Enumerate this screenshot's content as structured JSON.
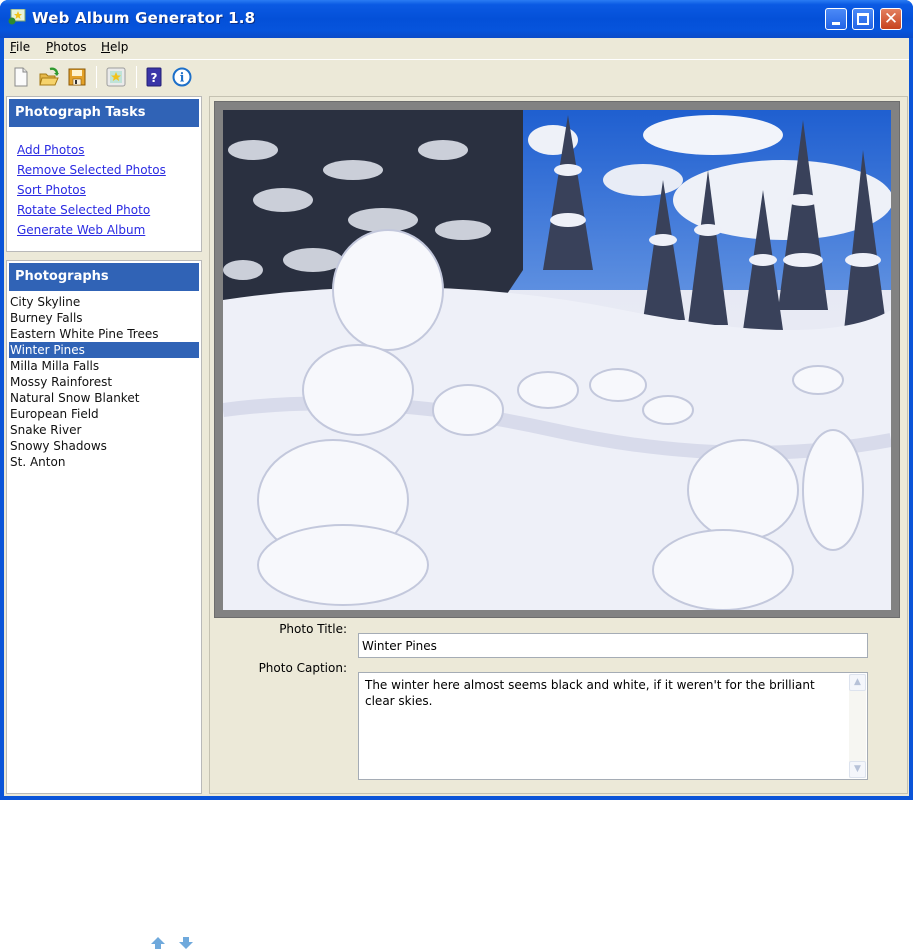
{
  "window": {
    "title": "Web Album Generator 1.8",
    "controls": {
      "minimize": "_",
      "maximize": "□",
      "close": "✕"
    }
  },
  "menu": [
    {
      "label": "File",
      "accel": "F",
      "rest": "ile"
    },
    {
      "label": "Photos",
      "accel": "P",
      "rest": "hotos"
    },
    {
      "label": "Help",
      "accel": "H",
      "rest": "elp"
    }
  ],
  "toolbar": {
    "items": [
      {
        "name": "new",
        "icon": "new-document-icon"
      },
      {
        "name": "open",
        "icon": "open-folder-icon"
      },
      {
        "name": "save",
        "icon": "save-disk-icon"
      },
      {
        "name": "album-preview",
        "icon": "picture-star-icon"
      },
      {
        "name": "help",
        "icon": "help-book-icon"
      },
      {
        "name": "about",
        "icon": "info-icon"
      }
    ]
  },
  "tasks": {
    "header": "Photograph Tasks",
    "links": [
      "Add Photos",
      "Remove Selected Photos",
      "Sort Photos",
      "Rotate Selected Photo",
      "Generate Web Album"
    ]
  },
  "photographs": {
    "header": "Photographs",
    "items": [
      "City Skyline",
      "Burney Falls",
      "Eastern White Pine Trees",
      "Winter Pines",
      "Milla Milla Falls",
      "Mossy Rainforest",
      "Natural Snow Blanket",
      "European Field",
      "Snake River",
      "Snowy Shadows",
      "St. Anton"
    ],
    "selected_index": 3,
    "move_up": "move-up-arrow-icon",
    "move_down": "move-down-arrow-icon"
  },
  "details": {
    "title_label": "Photo Title:",
    "title_value": "Winter Pines",
    "caption_label": "Photo Caption:",
    "caption_value": "The winter here almost seems black and white, if it weren't for the brilliant clear skies."
  },
  "colors": {
    "titlebar": "#0450d8",
    "panel_header": "#3063b6",
    "link": "#2b2be2",
    "selection": "#3063b6",
    "window_bg": "#ece9d8"
  }
}
